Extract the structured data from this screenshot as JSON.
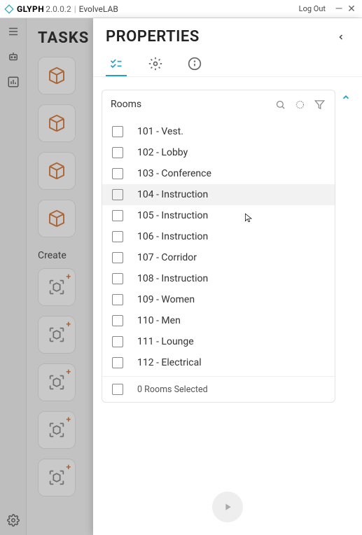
{
  "titlebar": {
    "app": "GLYPH",
    "version": "2.0.0.2",
    "company": "EvolveLAB",
    "logout": "Log Out"
  },
  "tasks": {
    "title": "TASKS",
    "create_label": "Create"
  },
  "panel": {
    "title": "PROPERTIES",
    "section_name": "Rooms",
    "rooms": [
      "101 - Vest.",
      "102 - Lobby",
      "103 - Conference",
      "104 - Instruction",
      "105 - Instruction",
      "106 - Instruction",
      "107 - Corridor",
      "108 - Instruction",
      "109 - Women",
      "110 - Men",
      "111 - Lounge",
      "112 - Electrical"
    ],
    "footer_text": "0 Rooms Selected"
  }
}
